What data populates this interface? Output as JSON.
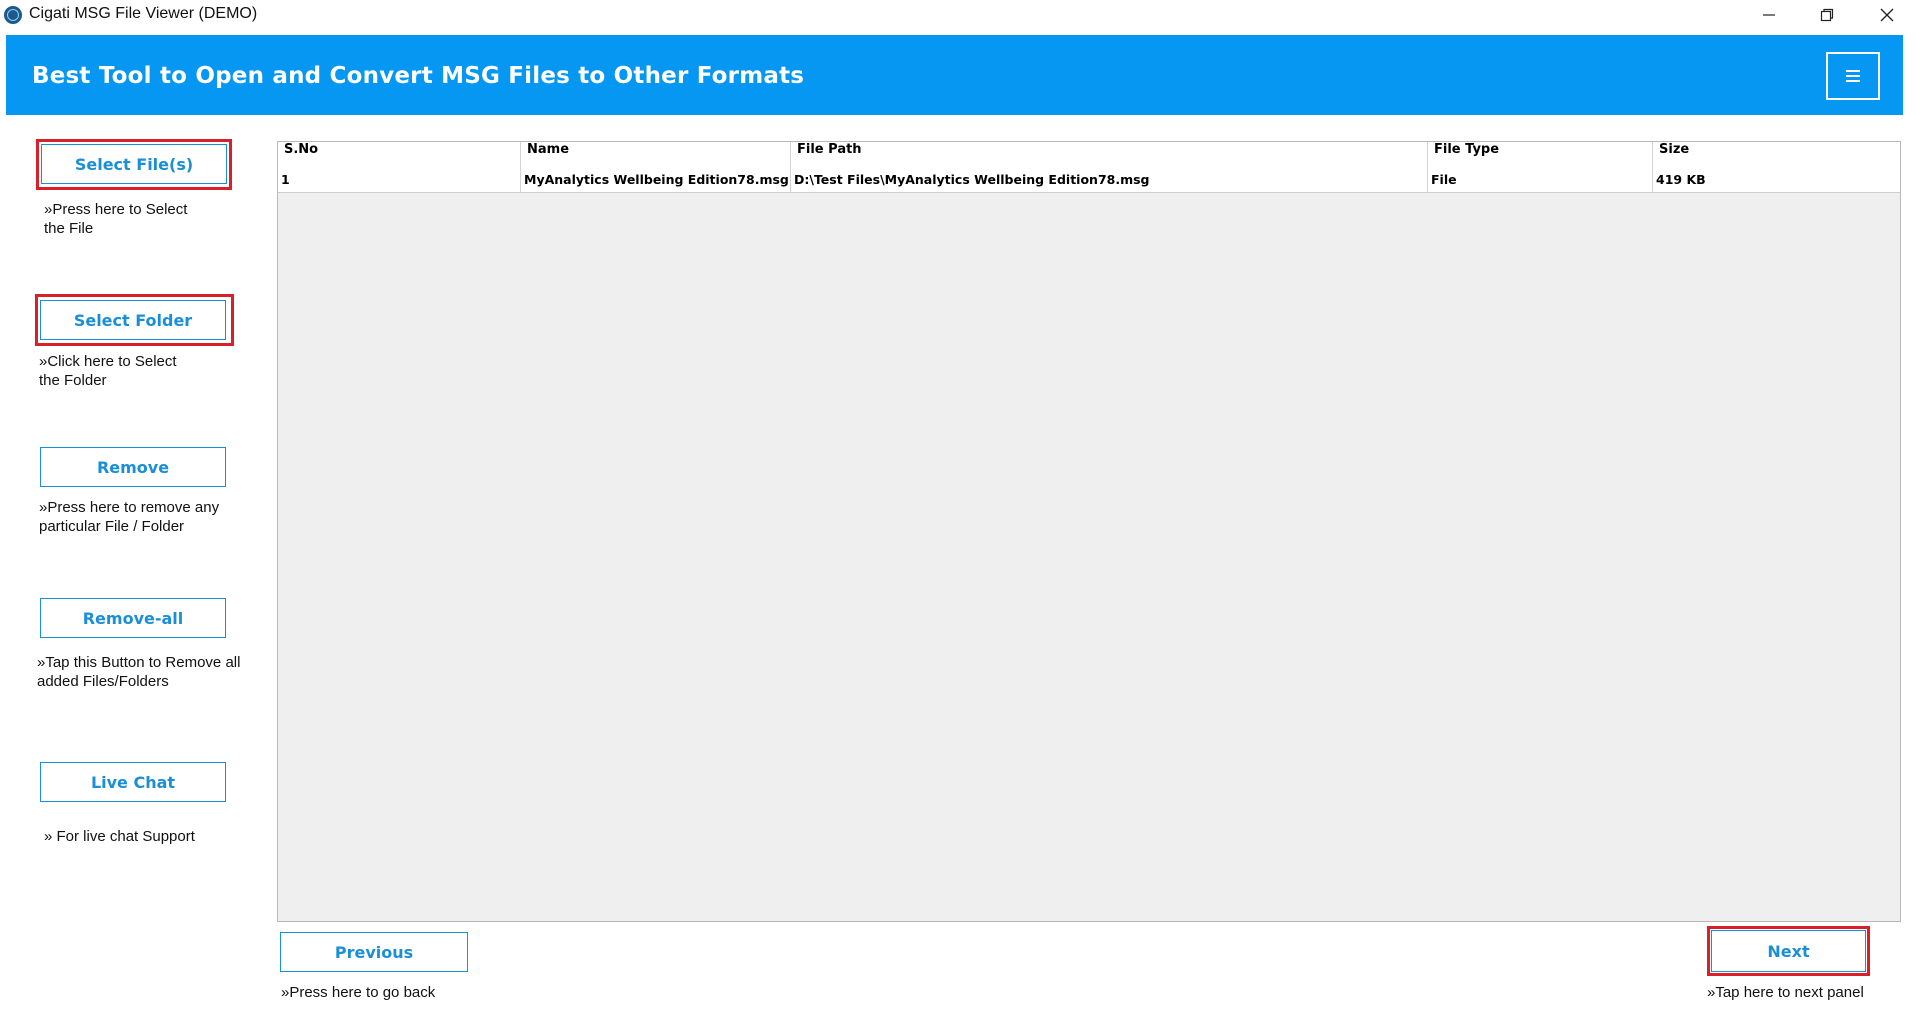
{
  "window": {
    "title": "Cigati MSG File Viewer (DEMO)",
    "controls": {
      "minimize": "minimize-icon",
      "maximize": "restore-icon",
      "close": "close-icon"
    }
  },
  "header": {
    "title": "Best Tool to Open and Convert MSG Files to Other Formats",
    "menu_icon": "hamburger-menu-icon",
    "background": "#0597f2"
  },
  "sidebar": {
    "select_files": {
      "label": "Select File(s)",
      "hint": "»Press here to Select\nthe File"
    },
    "select_folder": {
      "label": "Select Folder",
      "hint": "»Click here to Select\nthe Folder"
    },
    "remove": {
      "label": "Remove",
      "hint": "»Press here to remove any\nparticular File / Folder"
    },
    "remove_all": {
      "label": "Remove-all",
      "hint": "»Tap this Button to Remove all\nadded Files/Folders"
    },
    "live_chat": {
      "label": "Live Chat",
      "hint": "» For live chat Support"
    }
  },
  "table": {
    "columns": [
      "S.No",
      "Name",
      "File Path",
      "File Type",
      "Size"
    ],
    "rows": [
      [
        "1",
        "MyAnalytics Wellbeing Edition78.msg",
        "D:\\Test Files\\MyAnalytics Wellbeing Edition78.msg",
        "File",
        "419 KB"
      ]
    ]
  },
  "footer": {
    "previous": {
      "label": "Previous",
      "hint": "»Press here to go back"
    },
    "next": {
      "label": "Next",
      "hint": "»Tap here to next panel"
    }
  },
  "colors": {
    "accent": "#1b8fd6",
    "highlight": "#d81f2a"
  }
}
